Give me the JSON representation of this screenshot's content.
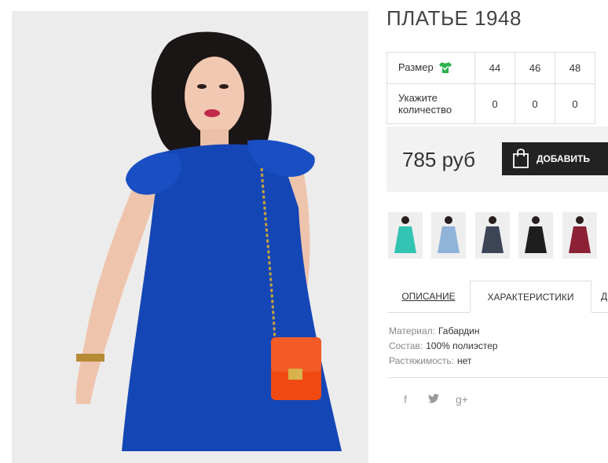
{
  "product": {
    "title": "ПЛАТЬЕ 1948",
    "image_icon": "dress-photo"
  },
  "sizes": {
    "size_label": "Размер",
    "qty_label_line1": "Укажите",
    "qty_label_line2": "количество",
    "values": [
      "44",
      "46",
      "48"
    ],
    "quantities": [
      "0",
      "0",
      "0"
    ],
    "size_icon": "green-shirt-icon",
    "accent_color": "#2bb24c"
  },
  "buy": {
    "price": "785 руб",
    "add_label": "ДОБАВИТЬ",
    "bag_icon": "shopping-bag-icon"
  },
  "thumbnails": [
    {
      "name": "thumb-turquoise",
      "color": "#33c3b3"
    },
    {
      "name": "thumb-lightblue",
      "color": "#8fb3d9"
    },
    {
      "name": "thumb-navy",
      "color": "#3c4556"
    },
    {
      "name": "thumb-black",
      "color": "#1e1e1e"
    },
    {
      "name": "thumb-burgundy",
      "color": "#8c2035"
    }
  ],
  "tabs": {
    "description": "ОПИСАНИЕ",
    "characteristics": "ХАРАКТЕРИСТИКИ",
    "more": "Д"
  },
  "specs": [
    {
      "key": "Материал:",
      "value": "Габардин"
    },
    {
      "key": "Состав:",
      "value": "100% полиэстер"
    },
    {
      "key": "Растяжимость:",
      "value": "нет"
    }
  ],
  "social": {
    "facebook": "f",
    "twitter": "twitter-icon",
    "google": "g+"
  },
  "colors": {
    "dress_blue": "#1546b6",
    "bag_orange": "#f04a12",
    "button_dark": "#222222",
    "buybox_bg": "#f2f2f2"
  }
}
